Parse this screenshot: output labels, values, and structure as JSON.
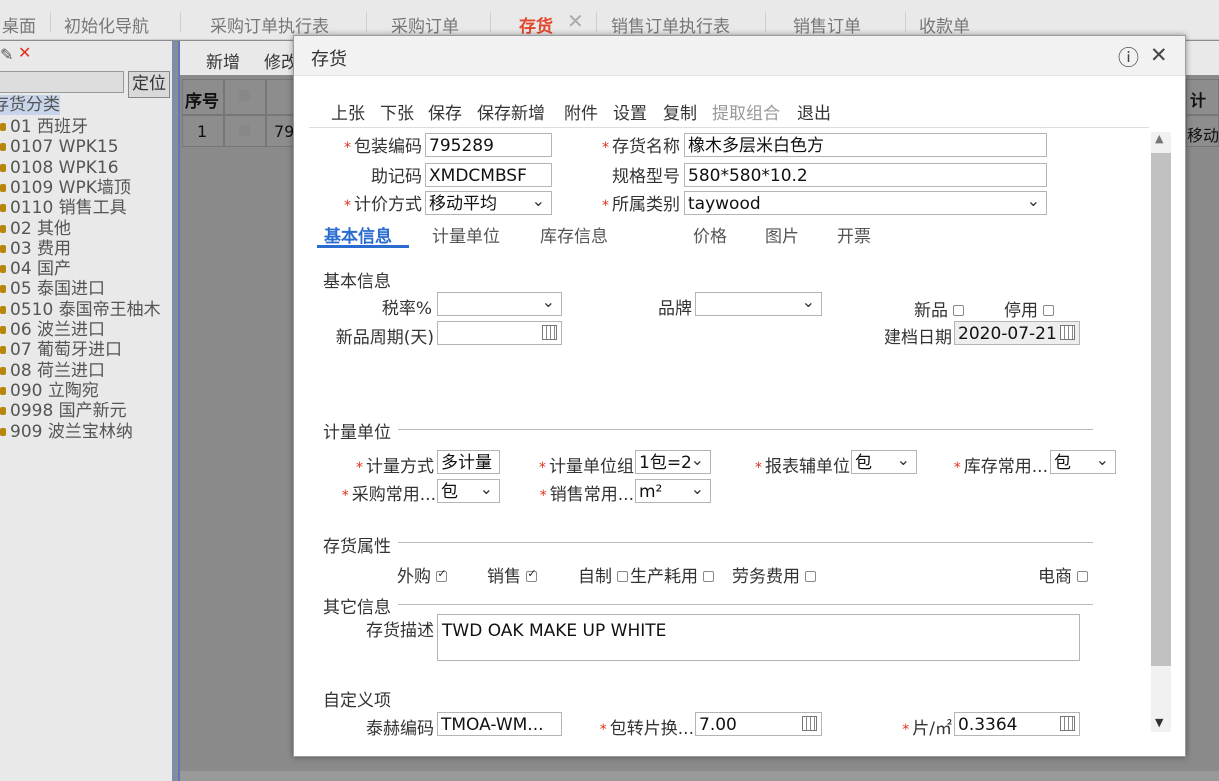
{
  "tabs": [
    {
      "label": "桌面"
    },
    {
      "label": "初始化导航"
    },
    {
      "label": "采购订单执行表"
    },
    {
      "label": "采购订单"
    },
    {
      "label": "存货",
      "active": true
    },
    {
      "label": "销售订单执行表"
    },
    {
      "label": "销售订单"
    },
    {
      "label": "收款单"
    }
  ],
  "left": {
    "locate_label": "定位",
    "tree_root": "存货分类",
    "tree_items": [
      "01 西班牙",
      "0107 WPK15",
      "0108 WPK16",
      "0109 WPK墙顶",
      "0110 销售工具",
      "02 其他",
      "03 费用",
      "04 国产",
      "05 泰国进口",
      "0510 泰国帝王柚木",
      "06 波兰进口",
      "07 葡萄牙进口",
      "08 荷兰进口",
      "090 立陶宛",
      "0998 国产新元",
      "909 波兰宝林纳"
    ]
  },
  "main": {
    "toolbar": [
      "新增",
      "修改"
    ],
    "grid": {
      "seq_header": "序号",
      "row_seq": "1",
      "row_code": "79",
      "right_header": "计价",
      "right_cell": "移动平"
    }
  },
  "modal": {
    "title": "存货",
    "toolbar": [
      {
        "label": "上张",
        "disabled": false
      },
      {
        "label": "下张",
        "disabled": false
      },
      {
        "label": "保存",
        "disabled": false
      },
      {
        "label": "保存新增",
        "disabled": false
      },
      {
        "label": "附件",
        "disabled": false
      },
      {
        "label": "设置",
        "disabled": false
      },
      {
        "label": "复制",
        "disabled": false
      },
      {
        "label": "提取组合",
        "disabled": true
      },
      {
        "label": "退出",
        "disabled": false
      }
    ],
    "header_fields": {
      "pack_code_label": "包装编码",
      "pack_code": "795289",
      "name_label": "存货名称",
      "name": "橡木多层米白色方",
      "mnemonic_label": "助记码",
      "mnemonic": "XMDCMBSF",
      "spec_label": "规格型号",
      "spec": "580*580*10.2",
      "pricing_label": "计价方式",
      "pricing": "移动平均",
      "category_label": "所属类别",
      "category": "taywood"
    },
    "subtabs": [
      {
        "label": "基本信息",
        "active": true
      },
      {
        "label": "计量单位"
      },
      {
        "label": "库存信息"
      },
      {
        "label": "价格"
      },
      {
        "label": "图片"
      },
      {
        "label": "开票"
      }
    ],
    "basic": {
      "section": "基本信息",
      "tax_label": "税率%",
      "tax": "",
      "brand_label": "品牌",
      "brand": "",
      "new_label": "新品",
      "disabled_label": "停用",
      "new_period_label": "新品周期(天)",
      "new_period": "",
      "created_label": "建档日期",
      "created": "2020-07-21"
    },
    "units": {
      "section": "计量单位",
      "method_label": "计量方式",
      "method": "多计量",
      "group_label": "计量单位组",
      "group": "1包=2",
      "report_label": "报表辅单位",
      "report": "包",
      "stock_label": "库存常用...",
      "stock": "包",
      "purchase_label": "采购常用...",
      "purchase": "包",
      "sales_label": "销售常用...",
      "sales": "m²"
    },
    "attrs": {
      "section": "存货属性",
      "outsourced": "外购",
      "sales": "销售",
      "selfmade": "自制",
      "production": "生产耗用",
      "service": "劳务费用",
      "ecommerce": "电商"
    },
    "other": {
      "section": "其它信息",
      "desc_label": "存货描述",
      "desc": "TWD OAK MAKE UP WHITE"
    },
    "custom": {
      "section": "自定义项",
      "taihe_label": "泰赫编码",
      "taihe": "TMOA-WM...",
      "conv_label": "包转片换...",
      "conv": "7.00",
      "perm2_label": "片/㎡",
      "perm2": "0.3364"
    }
  }
}
